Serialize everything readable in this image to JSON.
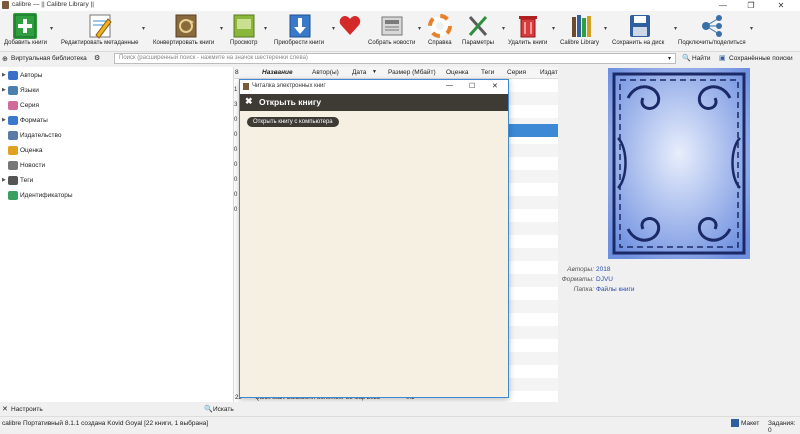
{
  "window": {
    "title": "calibre — || Calibre Library ||",
    "minimize_icon": "—",
    "restore_icon": "❐",
    "close_icon": "✕"
  },
  "toolbar": {
    "add_books": "Добавить книги",
    "edit_metadata": "Редактировать метаданные",
    "convert_books": "Конвертировать книги",
    "view": "Просмотр",
    "get_books": "Приобрести книги",
    "fetch_news": "Собрать новости",
    "help": "Справка",
    "preferences": "Параметры",
    "remove_books": "Удалить книги",
    "calibre_library": "Calibre Library",
    "save_to_disk": "Сохранить на диск",
    "connect_share": "Подключить/поделиться",
    "colors": {
      "add": "#2e9e3e",
      "edit": "#3a8fd0",
      "convert": "#8a6a3c",
      "view": "#8ab63a",
      "get": "#3a78c9",
      "heart": "#d42a2a",
      "news": "#7b7b7b",
      "help": "#e8822a",
      "prefs": "#5c5c5c",
      "remove": "#d93a3a",
      "library": "#6b4a2f",
      "save": "#2f5f9f",
      "connect": "#3a6fa8"
    }
  },
  "search": {
    "virtual_library": "Виртуальная библиотека",
    "placeholder": "Поиск (расширенный поиск - нажмите на значок шестеренки слева)",
    "find": "Найти",
    "saved_searches": "Сохранённые поиски"
  },
  "tag_browser": {
    "items": [
      {
        "label": "Авторы",
        "icon": "person-icon",
        "color": "#3a6fc9",
        "expandable": true
      },
      {
        "label": "Языки",
        "icon": "languages-icon",
        "color": "#4a7fb0",
        "expandable": true
      },
      {
        "label": "Серия",
        "icon": "series-icon",
        "color": "#d06a9a",
        "expandable": false
      },
      {
        "label": "Форматы",
        "icon": "formats-icon",
        "color": "#3a78c9",
        "expandable": true
      },
      {
        "label": "Издательство",
        "icon": "publisher-icon",
        "color": "#5a7aa8",
        "expandable": false
      },
      {
        "label": "Оценка",
        "icon": "star-icon",
        "color": "#e0a020",
        "expandable": false
      },
      {
        "label": "Новости",
        "icon": "news-icon",
        "color": "#777777",
        "expandable": false
      },
      {
        "label": "Теги",
        "icon": "tags-icon",
        "color": "#555555",
        "expandable": true
      },
      {
        "label": "Идентификаторы",
        "icon": "identifiers-icon",
        "color": "#3aa060",
        "expandable": false
      }
    ]
  },
  "book_list": {
    "headers": {
      "num": "8",
      "title": "Название",
      "authors": "Автор(ы)",
      "date": "Дата",
      "size": "Размер (Мбайт)",
      "rating": "Оценка",
      "tags": "Теги",
      "series": "Серия",
      "publisher": "Издат"
    },
    "row_numbers": [
      "1",
      "3",
      "0",
      "0",
      "0",
      "0",
      "0",
      "0",
      "0"
    ],
    "last_row": {
      "num": "22",
      "title": "Quick Start Guide",
      "author": "John Schember",
      "date": "28 мар 2025",
      "size": "0.1"
    },
    "selected_color": "#3d89d6"
  },
  "viewer": {
    "window_title": "Читалка электронных книг",
    "header": "Открыть книгу",
    "close_glyph": "✖",
    "open_button": "Открыть книгу с компьютера",
    "min_glyph": "—",
    "max_glyph": "☐",
    "close_win_glyph": "✕"
  },
  "details": {
    "authors_key": "Авторы:",
    "authors_val": "2018",
    "formats_key": "Форматы:",
    "formats_val": "DJVU",
    "folder_key": "Папка:",
    "folder_val": "Файлы книги",
    "cover_color": "#7a9ee8"
  },
  "bottom": {
    "configure": "Настроить",
    "find": "Искать"
  },
  "status": {
    "text": "calibre Портативный 8.1.1 создана Kovid Goyal   [22 книги, 1 выбрана]",
    "layout": "Макет",
    "jobs": "Задания: 0"
  }
}
